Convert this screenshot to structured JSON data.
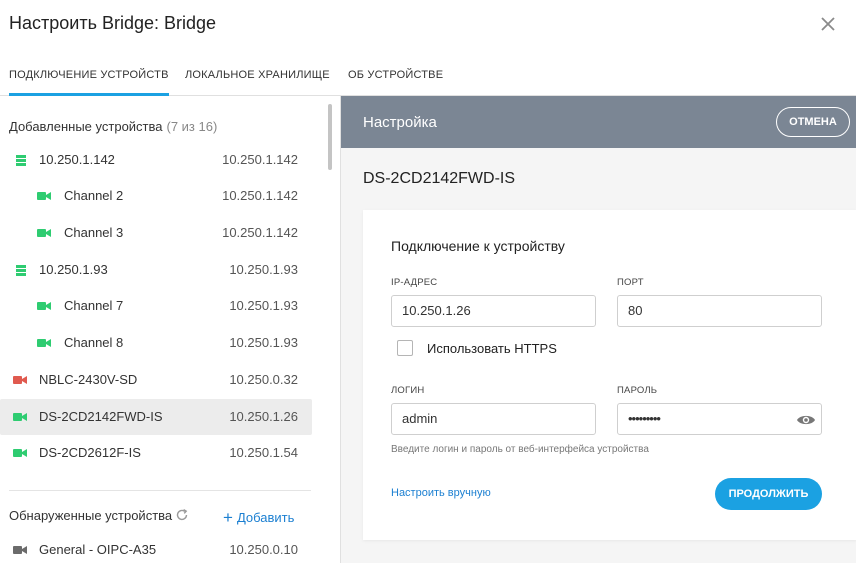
{
  "window": {
    "title": "Настроить Bridge: Bridge"
  },
  "tabs": [
    {
      "label": "ПОДКЛЮЧЕНИЕ УСТРОЙСТВ",
      "active": true
    },
    {
      "label": "ЛОКАЛЬНОЕ ХРАНИЛИЩЕ",
      "active": false
    },
    {
      "label": "ОБ УСТРОЙСТВЕ",
      "active": false
    }
  ],
  "added": {
    "title": "Добавленные устройства",
    "count": "(7 из 16)",
    "rows": [
      {
        "name": "10.250.1.142",
        "ip": "10.250.1.142",
        "icon": "server-icon"
      },
      {
        "name": "Channel 2",
        "ip": "10.250.1.142",
        "icon": "camera-icon"
      },
      {
        "name": "Channel 3",
        "ip": "10.250.1.142",
        "icon": "camera-icon"
      },
      {
        "name": "10.250.1.93",
        "ip": "10.250.1.93",
        "icon": "server-icon"
      },
      {
        "name": "Channel 7",
        "ip": "10.250.1.93",
        "icon": "camera-icon"
      },
      {
        "name": "Channel 8",
        "ip": "10.250.1.93",
        "icon": "camera-icon"
      },
      {
        "name": "NBLC-2430V-SD",
        "ip": "10.250.0.32",
        "icon": "camera-icon"
      },
      {
        "name": "DS-2CD2142FWD-IS",
        "ip": "10.250.1.26",
        "icon": "camera-icon"
      },
      {
        "name": "DS-2CD2612F-IS",
        "ip": "10.250.1.54",
        "icon": "camera-icon"
      }
    ]
  },
  "discovered": {
    "title": "Обнаруженные устройства",
    "add_label": "Добавить",
    "rows": [
      {
        "name": "General - OIPC-A35",
        "ip": "10.250.0.10",
        "icon": "camera-icon"
      }
    ]
  },
  "panel": {
    "header_title": "Настройка",
    "cancel_label": "ОТМЕНА",
    "device_name": "DS-2CD2142FWD-IS",
    "card_title": "Подключение к устройству",
    "ip_label": "IP-АДРЕС",
    "ip_value": "10.250.1.26",
    "port_label": "ПОРТ",
    "port_value": "80",
    "https_label": "Использовать HTTPS",
    "login_label": "ЛОГИН",
    "login_value": "admin",
    "password_label": "ПАРОЛЬ",
    "password_value": "•••••••••",
    "hint": "Введите логин и пароль от веб-интерфейса устройства",
    "manual_label": "Настроить вручную",
    "continue_label": "ПРОДОЛЖИТЬ"
  },
  "colors": {
    "accent": "#1ba1e2",
    "online": "#2ecc71",
    "offline": "#e05a4f",
    "unknown": "#6b6b6b",
    "header_bg": "#7b8694"
  }
}
